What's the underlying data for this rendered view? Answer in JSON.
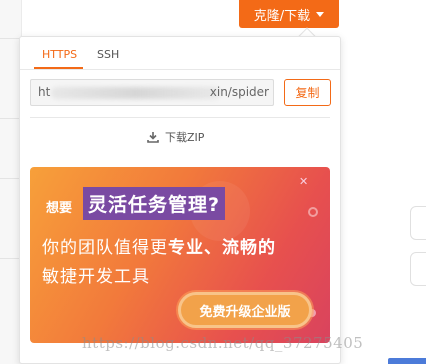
{
  "clone_button": {
    "label": "克隆/下载"
  },
  "tabs": [
    {
      "label": "HTTPS",
      "active": true
    },
    {
      "label": "SSH",
      "active": false
    }
  ],
  "url_field": {
    "prefix": "ht",
    "suffix": "xin/spider"
  },
  "copy_button": {
    "label": "复制"
  },
  "download": {
    "label": "下载ZIP",
    "icon": "download-icon"
  },
  "banner": {
    "small_text": "想要",
    "highlight_text": "灵活任务管理?",
    "line2_prefix": "你的团队值得更",
    "line2_bold": "专业、流畅的",
    "line3": "敏捷开发工具",
    "button_label": "免费升级企业版"
  },
  "watermark": "https://blog.csdn.net/qq_37275405",
  "colors": {
    "accent": "#f36a17",
    "highlight_bg": "#7a4aa2"
  }
}
